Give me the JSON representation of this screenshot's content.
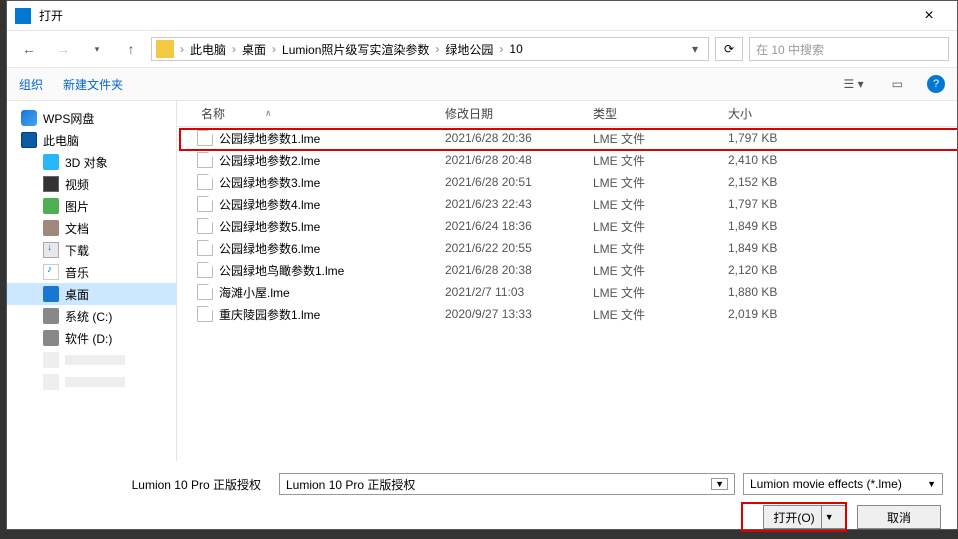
{
  "titlebar": {
    "title": "打开"
  },
  "breadcrumb": {
    "items": [
      "此电脑",
      "桌面",
      "Lumion照片级写实渲染参数",
      "绿地公园",
      "10"
    ]
  },
  "search": {
    "placeholder": "在 10 中搜索"
  },
  "toolbar": {
    "organize": "组织",
    "new_folder": "新建文件夹"
  },
  "sidebar": {
    "items": [
      {
        "label": "WPS网盘",
        "icon": "si-wps",
        "indent": false
      },
      {
        "label": "此电脑",
        "icon": "si-pc",
        "indent": false
      },
      {
        "label": "3D 对象",
        "icon": "si-3d",
        "indent": true
      },
      {
        "label": "视频",
        "icon": "si-video",
        "indent": true
      },
      {
        "label": "图片",
        "icon": "si-pic",
        "indent": true
      },
      {
        "label": "文档",
        "icon": "si-doc",
        "indent": true
      },
      {
        "label": "下载",
        "icon": "si-down",
        "indent": true
      },
      {
        "label": "音乐",
        "icon": "si-music",
        "indent": true
      },
      {
        "label": "桌面",
        "icon": "si-desk",
        "indent": true,
        "selected": true
      },
      {
        "label": "系统 (C:)",
        "icon": "si-drive",
        "indent": true
      },
      {
        "label": "软件 (D:)",
        "icon": "si-drive",
        "indent": true
      }
    ]
  },
  "columns": {
    "name": "名称",
    "date": "修改日期",
    "type": "类型",
    "size": "大小"
  },
  "files": [
    {
      "name": "公园绿地参数1.lme",
      "date": "2021/6/28 20:36",
      "type": "LME 文件",
      "size": "1,797 KB"
    },
    {
      "name": "公园绿地参数2.lme",
      "date": "2021/6/28 20:48",
      "type": "LME 文件",
      "size": "2,410 KB"
    },
    {
      "name": "公园绿地参数3.lme",
      "date": "2021/6/28 20:51",
      "type": "LME 文件",
      "size": "2,152 KB"
    },
    {
      "name": "公园绿地参数4.lme",
      "date": "2021/6/23 22:43",
      "type": "LME 文件",
      "size": "1,797 KB"
    },
    {
      "name": "公园绿地参数5.lme",
      "date": "2021/6/24 18:36",
      "type": "LME 文件",
      "size": "1,849 KB"
    },
    {
      "name": "公园绿地参数6.lme",
      "date": "2021/6/22 20:55",
      "type": "LME 文件",
      "size": "1,849 KB"
    },
    {
      "name": "公园绿地鸟瞰参数1.lme",
      "date": "2021/6/28 20:38",
      "type": "LME 文件",
      "size": "2,120 KB"
    },
    {
      "name": "海滩小屋.lme",
      "date": "2021/2/7 11:03",
      "type": "LME 文件",
      "size": "1,880 KB"
    },
    {
      "name": "重庆陵园参数1.lme",
      "date": "2020/9/27 13:33",
      "type": "LME 文件",
      "size": "2,019 KB"
    }
  ],
  "footer": {
    "license_label": "Lumion 10 Pro 正版授权",
    "filename_value": "Lumion 10 Pro 正版授权",
    "filter": "Lumion movie effects (*.lme)",
    "open": "打开(O)",
    "cancel": "取消"
  }
}
